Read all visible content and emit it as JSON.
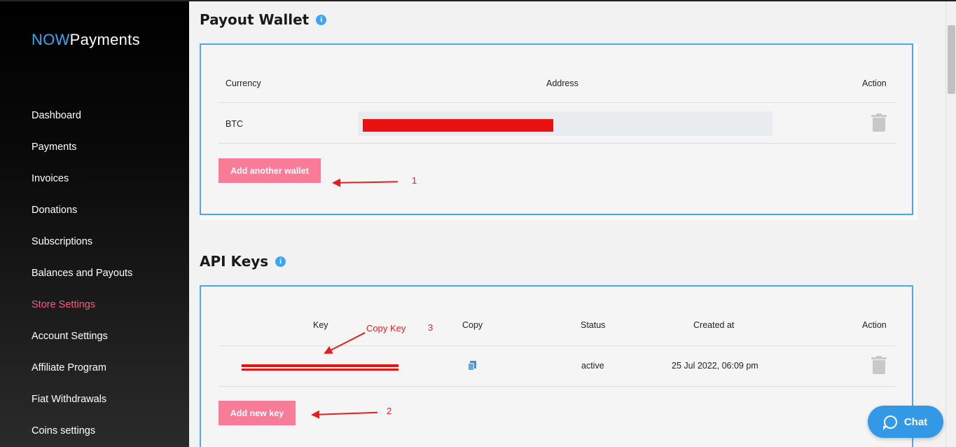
{
  "brand": {
    "now": "NOW",
    "payments": "Payments"
  },
  "sidebar": {
    "items": [
      {
        "label": "Dashboard"
      },
      {
        "label": "Payments"
      },
      {
        "label": "Invoices"
      },
      {
        "label": "Donations"
      },
      {
        "label": "Subscriptions"
      },
      {
        "label": "Balances and Payouts"
      },
      {
        "label": "Store Settings",
        "active": true
      },
      {
        "label": "Account Settings"
      },
      {
        "label": "Affiliate Program"
      },
      {
        "label": "Fiat Withdrawals"
      },
      {
        "label": "Coins settings"
      }
    ]
  },
  "payout_wallet": {
    "title": "Payout Wallet",
    "info_icon": "i",
    "columns": {
      "currency": "Currency",
      "address": "Address",
      "action": "Action"
    },
    "rows": [
      {
        "currency": "BTC"
      }
    ],
    "add_button": "Add another wallet"
  },
  "api_keys": {
    "title": "API Keys",
    "info_icon": "i",
    "columns": {
      "key": "Key",
      "copy": "Copy",
      "status": "Status",
      "created_at": "Created at",
      "action": "Action"
    },
    "rows": [
      {
        "status": "active",
        "created_at": "25 Jul 2022, 06:09 pm"
      }
    ],
    "add_button": "Add new key"
  },
  "annotations": {
    "one": "1",
    "two": "2",
    "three": "3",
    "copy_key": "Copy Key"
  },
  "chat": {
    "label": "Chat"
  },
  "colors": {
    "accent": "#3aa7f2",
    "pink": "#f87c97",
    "active_nav": "#f0607e",
    "redaction": "#e81212"
  }
}
